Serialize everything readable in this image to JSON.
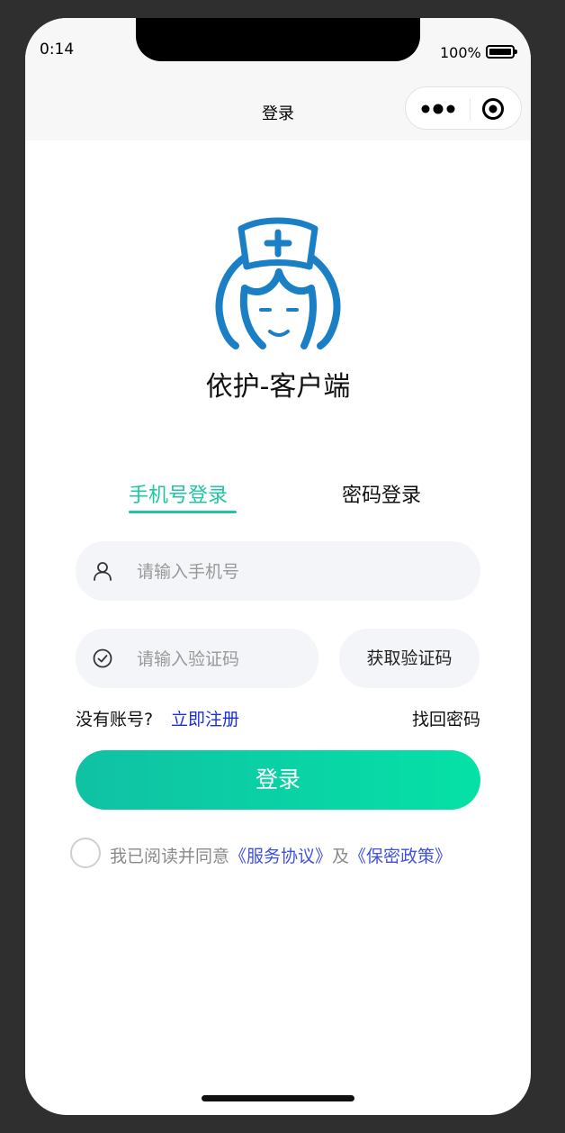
{
  "status_bar": {
    "time": "0:14",
    "battery_percent": "100%"
  },
  "nav": {
    "title": "登录"
  },
  "app": {
    "name": "依护-客户端"
  },
  "tabs": [
    {
      "label": "手机号登录",
      "active": true
    },
    {
      "label": "密码登录",
      "active": false
    }
  ],
  "form": {
    "phone_placeholder": "请输入手机号",
    "code_placeholder": "请输入验证码",
    "get_code_label": "获取验证码"
  },
  "links": {
    "no_account": "没有账号?",
    "register": "立即注册",
    "forgot": "找回密码"
  },
  "login_label": "登录",
  "agreement": {
    "prefix": "我已阅读并同意",
    "service": "《服务协议》",
    "and": "及",
    "privacy": "《保密政策》",
    "checked": false
  },
  "colors": {
    "accent": "#1fc6a4",
    "link": "#1a2fe0",
    "logo_blue": "#1a7fc4",
    "button_gradient": [
      "#10c1a4",
      "#05e1a6"
    ]
  },
  "icons": [
    "battery-icon",
    "more-icon",
    "capsule-target-icon",
    "nurse-logo-icon",
    "user-icon",
    "check-circle-icon"
  ]
}
